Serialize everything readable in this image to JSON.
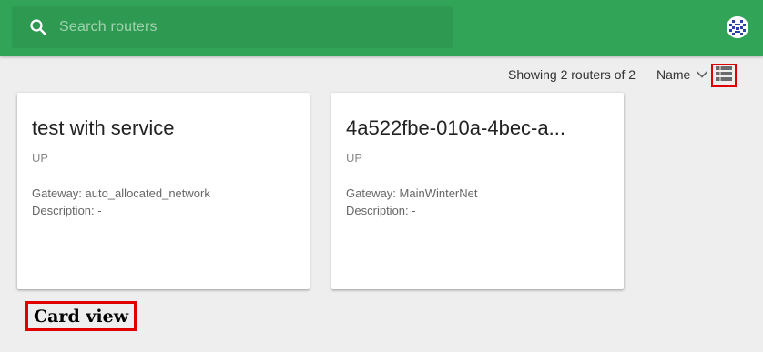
{
  "header": {
    "search": {
      "placeholder": "Search routers",
      "icon": "search-icon"
    },
    "avatar_icon": "user-avatar-icon",
    "bar_color": "#31a457"
  },
  "toolbar": {
    "count_text": "Showing 2 routers of 2",
    "sort_label": "Name",
    "sort_icon": "chevron-down-icon",
    "view_toggle_icon": "list-view-icon"
  },
  "routers": [
    {
      "name": "test with service",
      "status": "UP",
      "gateway": "Gateway: auto_allocated_network",
      "description": "Description: -"
    },
    {
      "name": "4a522fbe-010a-4bec-a...",
      "status": "UP",
      "gateway": "Gateway: MainWinterNet",
      "description": "Description: -"
    }
  ],
  "annotation": {
    "label": "Card view",
    "highlight_color": "#e00000"
  }
}
